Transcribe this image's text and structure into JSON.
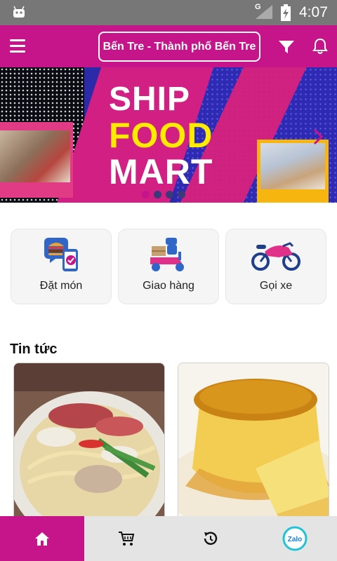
{
  "status_bar": {
    "time": "4:07",
    "network": "G"
  },
  "app_bar": {
    "location_label": "Bến Tre - Thành phố Bến Tre"
  },
  "banner": {
    "line1": "SHIP",
    "line2": "FOOD",
    "line3": "MART",
    "slide_count": 4,
    "active_slide": 1
  },
  "services": [
    {
      "label": "Đặt món",
      "icon": "food-order-icon"
    },
    {
      "label": "Giao hàng",
      "icon": "delivery-scooter-icon"
    },
    {
      "label": "Gọi xe",
      "icon": "motorbike-icon"
    }
  ],
  "news": {
    "title": "Tin tức",
    "items": [
      {
        "image": "noodle-soup-photo"
      },
      {
        "image": "flan-pudding-photo"
      }
    ]
  },
  "bottom_nav": {
    "items": [
      {
        "icon": "home-icon",
        "active": true
      },
      {
        "icon": "cart-icon",
        "active": false
      },
      {
        "icon": "history-icon",
        "active": false
      },
      {
        "icon": "zalo-icon",
        "label": "Zalo",
        "active": false
      }
    ]
  },
  "colors": {
    "brand": "#c6158a",
    "accent_yellow": "#ffeb00",
    "banner_blue": "#2e2ab3"
  }
}
